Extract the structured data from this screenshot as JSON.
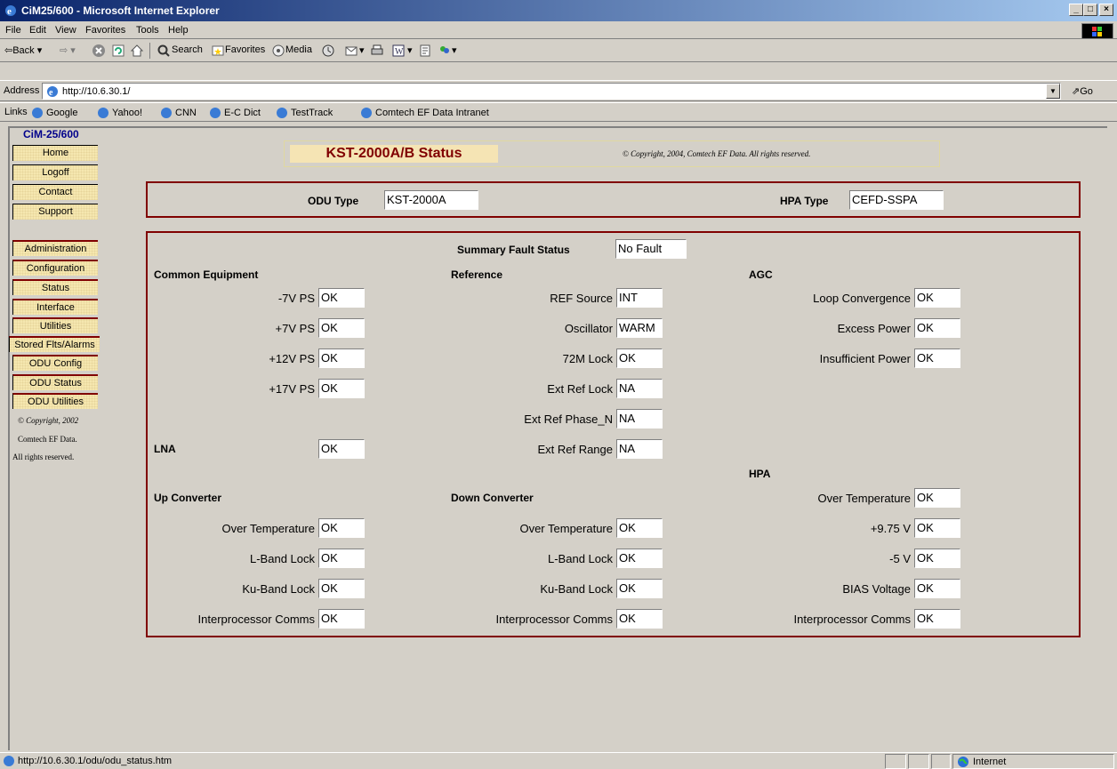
{
  "window": {
    "title": "CiM25/600 - Microsoft Internet Explorer",
    "min": "_",
    "max": "□",
    "close": "×"
  },
  "menu": [
    "File",
    "Edit",
    "View",
    "Favorites",
    "Tools",
    "Help"
  ],
  "toolbar": {
    "back": "Back",
    "search": "Search",
    "favorites": "Favorites",
    "media": "Media"
  },
  "address": {
    "label": "Address",
    "url": "http://10.6.30.1/",
    "go": "Go"
  },
  "links": {
    "label": "Links",
    "items": [
      "Google",
      "Yahoo!",
      "CNN",
      "E-C Dict",
      "TestTrack",
      "Comtech EF Data Intranet"
    ]
  },
  "sidebar": {
    "brand": "CiM-25/600",
    "top_buttons": [
      "Home",
      "Logoff",
      "Contact",
      "Support"
    ],
    "buttons": [
      "Administration",
      "Configuration",
      "Status",
      "Interface",
      "Utilities",
      "Stored Flts/Alarms",
      "ODU Config",
      "ODU Status",
      "ODU Utilities"
    ],
    "copyright": [
      "© Copyright, 2002",
      "Comtech EF Data.",
      "All rights reserved."
    ]
  },
  "header": {
    "title": "KST-2000A/B Status",
    "copyright": "© Copyright, 2004, Comtech EF Data. All rights reserved."
  },
  "types": {
    "odu_label": "ODU Type",
    "odu_value": "KST-2000A",
    "hpa_label": "HPA Type",
    "hpa_value": "CEFD-SSPA"
  },
  "summary": {
    "label": "Summary Fault Status",
    "value": "No Fault"
  },
  "common": {
    "heading": "Common Equipment",
    "rows": [
      {
        "label": "-7V PS",
        "value": "OK"
      },
      {
        "label": "+7V PS",
        "value": "OK"
      },
      {
        "label": "+12V PS",
        "value": "OK"
      },
      {
        "label": "+17V PS",
        "value": "OK"
      }
    ]
  },
  "reference": {
    "heading": "Reference",
    "rows": [
      {
        "label": "REF Source",
        "value": "INT"
      },
      {
        "label": "Oscillator",
        "value": "WARM"
      },
      {
        "label": "72M Lock",
        "value": "OK"
      },
      {
        "label": "Ext Ref Lock",
        "value": "NA"
      },
      {
        "label": "Ext Ref Phase_N",
        "value": "NA"
      },
      {
        "label": "Ext Ref Range",
        "value": "NA"
      }
    ]
  },
  "agc": {
    "heading": "AGC",
    "rows": [
      {
        "label": "Loop Convergence",
        "value": "OK"
      },
      {
        "label": "Excess Power",
        "value": "OK"
      },
      {
        "label": "Insufficient Power",
        "value": "OK"
      }
    ]
  },
  "lna": {
    "label": "LNA",
    "value": "OK"
  },
  "hpa": {
    "heading": "HPA",
    "rows": [
      {
        "label": "Over Temperature",
        "value": "OK"
      },
      {
        "label": "+9.75 V",
        "value": "OK"
      },
      {
        "label": "-5 V",
        "value": "OK"
      },
      {
        "label": "BIAS Voltage",
        "value": "OK"
      },
      {
        "label": "Interprocessor Comms",
        "value": "OK"
      }
    ]
  },
  "up": {
    "heading": "Up Converter",
    "rows": [
      {
        "label": "Over Temperature",
        "value": "OK"
      },
      {
        "label": "L-Band Lock",
        "value": "OK"
      },
      {
        "label": "Ku-Band Lock",
        "value": "OK"
      },
      {
        "label": "Interprocessor Comms",
        "value": "OK"
      }
    ]
  },
  "down": {
    "heading": "Down Converter",
    "rows": [
      {
        "label": "Over Temperature",
        "value": "OK"
      },
      {
        "label": "L-Band Lock",
        "value": "OK"
      },
      {
        "label": "Ku-Band Lock",
        "value": "OK"
      },
      {
        "label": "Interprocessor Comms",
        "value": "OK"
      }
    ]
  },
  "status": {
    "url": "http://10.6.30.1/odu/odu_status.htm",
    "zone": "Internet"
  }
}
